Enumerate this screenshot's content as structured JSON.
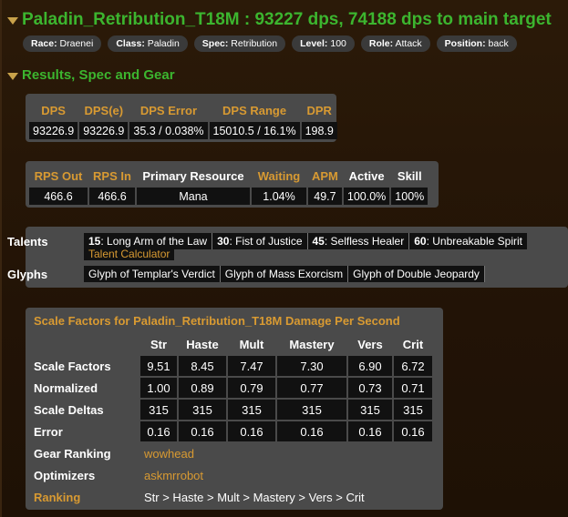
{
  "player": {
    "title": "Paladin_Retribution_T18M : 93227 dps, 74188 dps to main target"
  },
  "params": [
    {
      "key": "Race:",
      "value": "Draenei"
    },
    {
      "key": "Class:",
      "value": "Paladin"
    },
    {
      "key": "Spec:",
      "value": "Retribution"
    },
    {
      "key": "Level:",
      "value": "100"
    },
    {
      "key": "Role:",
      "value": "Attack"
    },
    {
      "key": "Position:",
      "value": "back"
    }
  ],
  "section": {
    "title": "Results, Spec and Gear"
  },
  "dps_table": {
    "headers": [
      "DPS",
      "DPS(e)",
      "DPS Error",
      "DPS Range",
      "DPR"
    ],
    "values": [
      "93226.9",
      "93226.9",
      "35.3 / 0.038%",
      "15010.5 / 16.1%",
      "198.9"
    ]
  },
  "resource_table": {
    "headers": [
      "RPS Out",
      "RPS In",
      "Primary Resource",
      "Waiting",
      "APM",
      "Active",
      "Skill"
    ],
    "values": [
      "466.6",
      "466.6",
      "Mana",
      "1.04%",
      "49.7",
      "100.0%",
      "100%"
    ]
  },
  "talents": {
    "label": "Talents",
    "items": [
      {
        "tier": "15",
        "name": ": Long Arm of the Law"
      },
      {
        "tier": "30",
        "name": ": Fist of Justice"
      },
      {
        "tier": "45",
        "name": ": Selfless Healer"
      },
      {
        "tier": "60",
        "name": ": Unbreakable Spirit"
      }
    ],
    "calculator_link": "Talent Calculator"
  },
  "glyphs": {
    "label": "Glyphs",
    "items": [
      "Glyph of Templar's Verdict",
      "Glyph of Mass Exorcism",
      "Glyph of Double Jeopardy"
    ]
  },
  "scale_factors": {
    "title": "Scale Factors for Paladin_Retribution_T18M Damage Per Second",
    "columns": [
      "Str",
      "Haste",
      "Mult",
      "Mastery",
      "Vers",
      "Crit"
    ],
    "rows": [
      {
        "label": "Scale Factors",
        "values": [
          "9.51",
          "8.45",
          "7.47",
          "7.30",
          "6.90",
          "6.72"
        ]
      },
      {
        "label": "Normalized",
        "values": [
          "1.00",
          "0.89",
          "0.79",
          "0.77",
          "0.73",
          "0.71"
        ]
      },
      {
        "label": "Scale Deltas",
        "values": [
          "315",
          "315",
          "315",
          "315",
          "315",
          "315"
        ]
      },
      {
        "label": "Error",
        "values": [
          "0.16",
          "0.16",
          "0.16",
          "0.16",
          "0.16",
          "0.16"
        ]
      }
    ],
    "gear_ranking_label": "Gear Ranking",
    "gear_ranking_link": "wowhead",
    "optimizers_label": "Optimizers",
    "optimizers_link": "askmrrobot",
    "ranking_label": "Ranking",
    "ranking_value": "Str > Haste > Mult > Mastery > Vers > Crit"
  },
  "colors": {
    "title_green": "#3cb52f",
    "header_gold": "#d89a32",
    "background": "#241505",
    "panel": "#4a4a4a"
  }
}
